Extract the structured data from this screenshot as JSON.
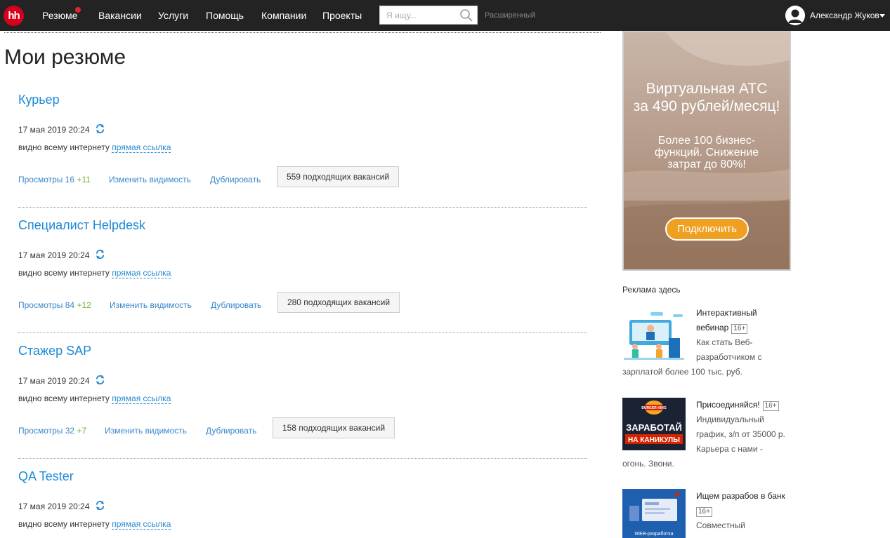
{
  "header": {
    "logo": "hh",
    "nav": [
      "Резюме",
      "Вакансии",
      "Услуги",
      "Помощь",
      "Компании",
      "Проекты"
    ],
    "search_placeholder": "Я ищу...",
    "advanced": "Расширенный",
    "user_name": "Александр Жуков"
  },
  "page_title": "Мои резюме",
  "resumes": [
    {
      "title": "Курьер",
      "date": "17 мая 2019 20:24",
      "visibility": "видно всему интернету",
      "direct_link": "прямая ссылка",
      "views_label": "Просмотры 16",
      "views_delta": "+11",
      "change_visibility": "Изменить видимость",
      "duplicate": "Дублировать",
      "vacancies": "559 подходящих вакансий"
    },
    {
      "title": "Специалист Helpdesk",
      "date": "17 мая 2019 20:24",
      "visibility": "видно всему интернету",
      "direct_link": "прямая ссылка",
      "views_label": "Просмотры 84",
      "views_delta": "+12",
      "change_visibility": "Изменить видимость",
      "duplicate": "Дублировать",
      "vacancies": "280 подходящих вакансий"
    },
    {
      "title": "Стажер SAP",
      "date": "17 мая 2019 20:24",
      "visibility": "видно всему интернету",
      "direct_link": "прямая ссылка",
      "views_label": "Просмотры 32",
      "views_delta": "+7",
      "change_visibility": "Изменить видимость",
      "duplicate": "Дублировать",
      "vacancies": "158 подходящих вакансий"
    },
    {
      "title": "QA Tester",
      "date": "17 мая 2019 20:24",
      "visibility": "видно всему интернету",
      "direct_link": "прямая ссылка"
    }
  ],
  "banner": {
    "title_line1": "Виртуальная АТС",
    "title_line2": "за 490 рублей/месяц!",
    "sub_line1": "Более 100 бизнес-",
    "sub_line2": "функций. Снижение",
    "sub_line3": "затрат до 80%!",
    "button": "Подключить"
  },
  "ads_label": "Реклама здесь",
  "ads": [
    {
      "line1": "Интерактивный",
      "line2": "вебинар",
      "age": "16+",
      "text1": "Как стать Веб-",
      "text2": "разработчиком с",
      "text3": "зарплатой более 100 тыс. руб."
    },
    {
      "line1": "Присоединяйся!",
      "age": "16+",
      "img_text1": "ЗАРАБОТАЙ",
      "img_text2": "НА КАНИКУЛЫ",
      "img_logo": "BURGER KING",
      "text1": "Индивидуальный",
      "text2": "график, з/п от 35000 р.",
      "text3": "Карьера с нами -",
      "text4": "огонь. Звони."
    },
    {
      "line1": "Ищем разрабов в банк",
      "age": "16+",
      "img_text": "WEB-разработка",
      "text1": "Совместный"
    }
  ],
  "colors": {
    "topbar": "#232323",
    "logo": "#d6001c",
    "link": "#1a8ad6",
    "delta": "#6db33f",
    "banner_button": "#f0a020"
  }
}
